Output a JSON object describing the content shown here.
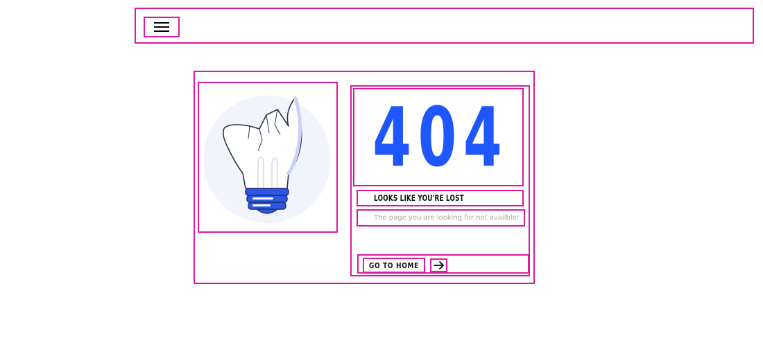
{
  "nav": {
    "menu_icon": "hamburger-menu-icon"
  },
  "error": {
    "code": "404",
    "headline": "Looks like you're lost",
    "message": "The page you are looking for not availble!",
    "illustration": "broken-lightbulb-illustration"
  },
  "actions": {
    "home_label": "Go to home",
    "arrow_icon": "arrow-right-icon"
  },
  "colors": {
    "accent": "#1e56ff",
    "outline": "#e0189e",
    "muted_text": "#a7a7a7"
  }
}
